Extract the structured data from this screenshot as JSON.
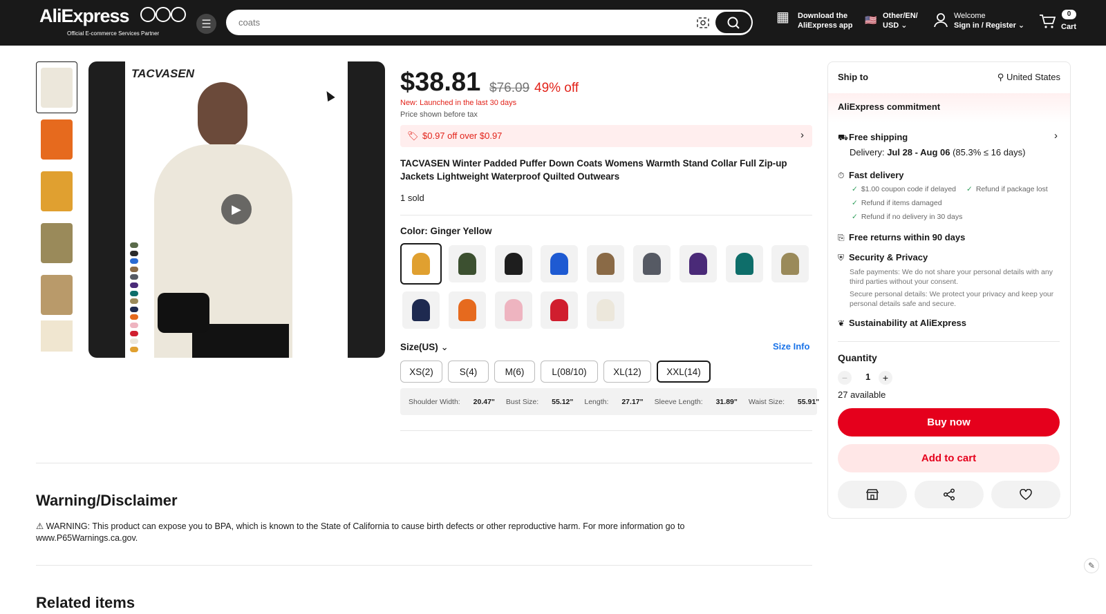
{
  "header": {
    "logo_text": "AliExpress",
    "logo_sub": "Official E-commerce Services Partner",
    "search_placeholder": "coats",
    "download_line1": "Download the",
    "download_line2": "AliExpress app",
    "locale_line1": "Other/EN/",
    "locale_line2": "USD",
    "welcome": "Welcome",
    "signin": "Sign in / Register",
    "cart_label": "Cart",
    "cart_count": "0"
  },
  "product": {
    "image_brand": "TACVASEN",
    "price": "$38.81",
    "old_price": "$76.09",
    "discount": "49% off",
    "new_tag": "New: Launched in the last 30 days",
    "tax_note": "Price shown before tax",
    "coupon": "$0.97 off over $0.97",
    "title": "TACVASEN Winter Padded Puffer Down Coats Womens Warmth Stand Collar Full Zip-up Jackets Lightweight Waterproof Quilted Outwears",
    "sold": "1 sold",
    "color_label": "Color: Ginger Yellow",
    "colors": [
      "#e0a030",
      "#3c5030",
      "#1e1e1e",
      "#1e5ad2",
      "#8a6a46",
      "#565a64",
      "#4a2a78",
      "#0e6e6a",
      "#9a8a5a",
      "#1e2a50",
      "#e66a1e",
      "#eeb4c0",
      "#d01e2e",
      "#ece7db"
    ],
    "size_label": "Size(US)",
    "size_info": "Size Info",
    "sizes": [
      "XS(2)",
      "S(4)",
      "M(6)",
      "L(08/10)",
      "XL(12)",
      "XXL(14)"
    ],
    "selected_size": "XXL(14)",
    "measurements": {
      "shoulder_label": "Shoulder Width:",
      "shoulder": "20.47\"",
      "bust_label": "Bust Size:",
      "bust": "55.12\"",
      "length_label": "Length:",
      "length": "27.17\"",
      "sleeve_label": "Sleeve Length:",
      "sleeve": "31.89\"",
      "waist_label": "Waist Size:",
      "waist": "55.91\""
    },
    "thumb_colors": [
      "#ece7db",
      "#e66a1e",
      "#e0a030",
      "#9a8a5a",
      "#b99a6a",
      "#f0e6d0"
    ],
    "dot_colors": [
      "#5a6a4a",
      "#2a2a2a",
      "#2a6ad2",
      "#8a6a46",
      "#565a64",
      "#4a2a78",
      "#0e6e6a",
      "#9a8a5a",
      "#1e2a50",
      "#e66a1e",
      "#eeb4c0",
      "#d01e2e",
      "#ece7db",
      "#e0a030"
    ]
  },
  "sidebar": {
    "ship_to": "Ship to",
    "country": "United States",
    "commitment": "AliExpress commitment",
    "free_shipping": "Free shipping",
    "delivery_prefix": "Delivery: ",
    "delivery_dates": "Jul 28 - Aug 06",
    "delivery_stats": " (85.3% ≤ 16 days)",
    "fast_delivery": "Fast delivery",
    "fd_item1": "$1.00 coupon code if delayed",
    "fd_item2": "Refund if package lost",
    "fd_item3": "Refund if items damaged",
    "fd_item4": "Refund if no delivery in 30 days",
    "free_returns": "Free returns within 90 days",
    "security": "Security & Privacy",
    "sec_text1": "Safe payments: We do not share your personal details with any third parties without your consent.",
    "sec_text2": "Secure personal details: We protect your privacy and keep your personal details safe and secure.",
    "sustainability": "Sustainability at AliExpress",
    "quantity_label": "Quantity",
    "quantity": "1",
    "available": "27 available",
    "buy_now": "Buy now",
    "add_to_cart": "Add to cart"
  },
  "warning": {
    "heading": "Warning/Disclaimer",
    "text": "⚠ WARNING: This product can expose you to BPA, which is known to the State of California to cause birth defects or other reproductive harm. For more information go to www.P65Warnings.ca.gov."
  },
  "related": {
    "heading": "Related items"
  }
}
